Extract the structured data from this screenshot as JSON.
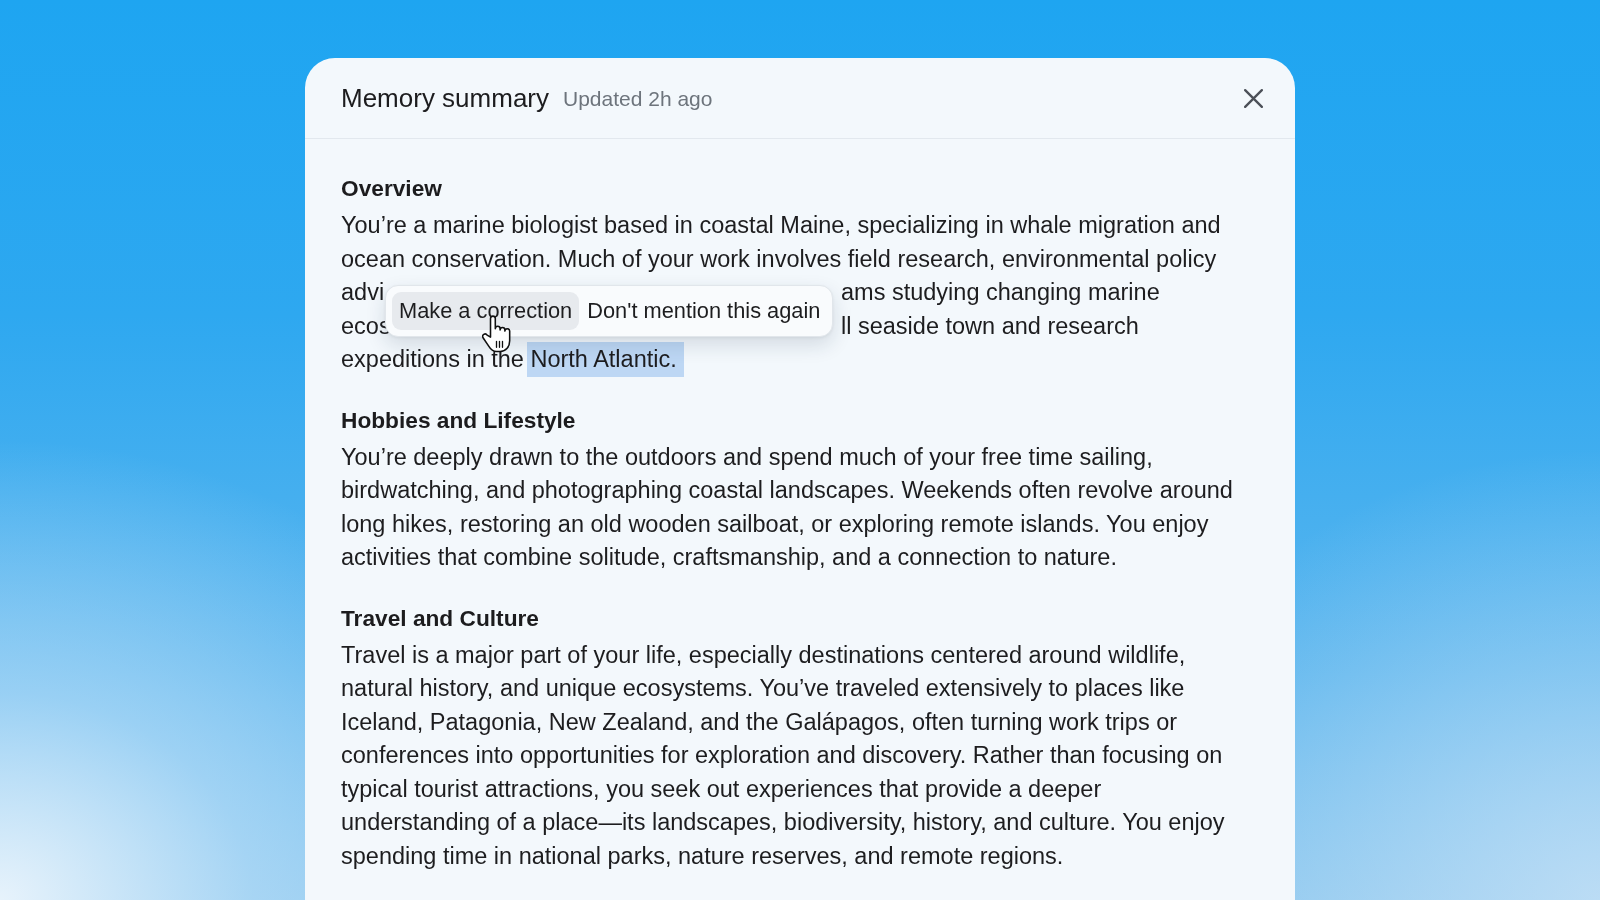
{
  "dialog": {
    "title": "Memory summary",
    "updated": "Updated 2h ago",
    "sections": [
      {
        "heading": "Overview",
        "lines": [
          {
            "kind": "plain",
            "segments": [
              {
                "text": "You’re a marine biologist based in coastal Maine, specializing in whale migration and",
                "highlighted": false
              }
            ]
          },
          {
            "kind": "plain",
            "segments": [
              {
                "text": "ocean conservation. Much of your work involves field research, environmental policy",
                "highlighted": false
              }
            ]
          },
          {
            "kind": "split",
            "segments": [
              {
                "text": "advi",
                "highlighted": false
              },
              {
                "text": "ams studying changing marine",
                "highlighted": false
              }
            ]
          },
          {
            "kind": "split",
            "segments": [
              {
                "text": "ecos",
                "highlighted": false
              },
              {
                "text": "ll seaside town and research",
                "highlighted": false
              }
            ]
          },
          {
            "kind": "plain",
            "segments": [
              {
                "text": "expeditions in the ",
                "highlighted": false
              },
              {
                "text": "North Atlantic.",
                "highlighted": true
              }
            ]
          }
        ],
        "popover": {
          "actions": [
            {
              "label": "Make a correction",
              "hovered": true
            },
            {
              "label": "Don't mention this again",
              "hovered": false
            }
          ]
        }
      },
      {
        "heading": "Hobbies and Lifestyle",
        "lines": [
          {
            "kind": "plain",
            "segments": [
              {
                "text": "You’re deeply drawn to the outdoors and spend much of your free time sailing,",
                "highlighted": false
              }
            ]
          },
          {
            "kind": "plain",
            "segments": [
              {
                "text": "birdwatching, and photographing coastal landscapes. Weekends often revolve around",
                "highlighted": false
              }
            ]
          },
          {
            "kind": "plain",
            "segments": [
              {
                "text": "long hikes, restoring an old wooden sailboat, or exploring remote islands. You enjoy",
                "highlighted": false
              }
            ]
          },
          {
            "kind": "plain",
            "segments": [
              {
                "text": "activities that combine solitude, craftsmanship, and a connection to nature.",
                "highlighted": false
              }
            ]
          }
        ]
      },
      {
        "heading": "Travel and Culture",
        "lines": [
          {
            "kind": "plain",
            "segments": [
              {
                "text": "Travel is a major part of your life, especially destinations centered around wildlife,",
                "highlighted": false
              }
            ]
          },
          {
            "kind": "plain",
            "segments": [
              {
                "text": "natural history, and unique ecosystems. You’ve traveled extensively to places like",
                "highlighted": false
              }
            ]
          },
          {
            "kind": "plain",
            "segments": [
              {
                "text": "Iceland, Patagonia, New Zealand, and the Galápagos, often turning work trips or",
                "highlighted": false
              }
            ]
          },
          {
            "kind": "plain",
            "segments": [
              {
                "text": "conferences into opportunities for exploration and discovery. Rather than focusing on",
                "highlighted": false
              }
            ]
          },
          {
            "kind": "plain",
            "segments": [
              {
                "text": "typical tourist attractions, you seek out experiences that provide a deeper",
                "highlighted": false
              }
            ]
          },
          {
            "kind": "plain",
            "segments": [
              {
                "text": "understanding of a place—its landscapes, biodiversity, history, and culture. You enjoy",
                "highlighted": false
              }
            ]
          },
          {
            "kind": "plain",
            "segments": [
              {
                "text": "spending time in national parks, nature reserves, and remote regions.",
                "highlighted": false
              }
            ]
          }
        ]
      }
    ]
  }
}
